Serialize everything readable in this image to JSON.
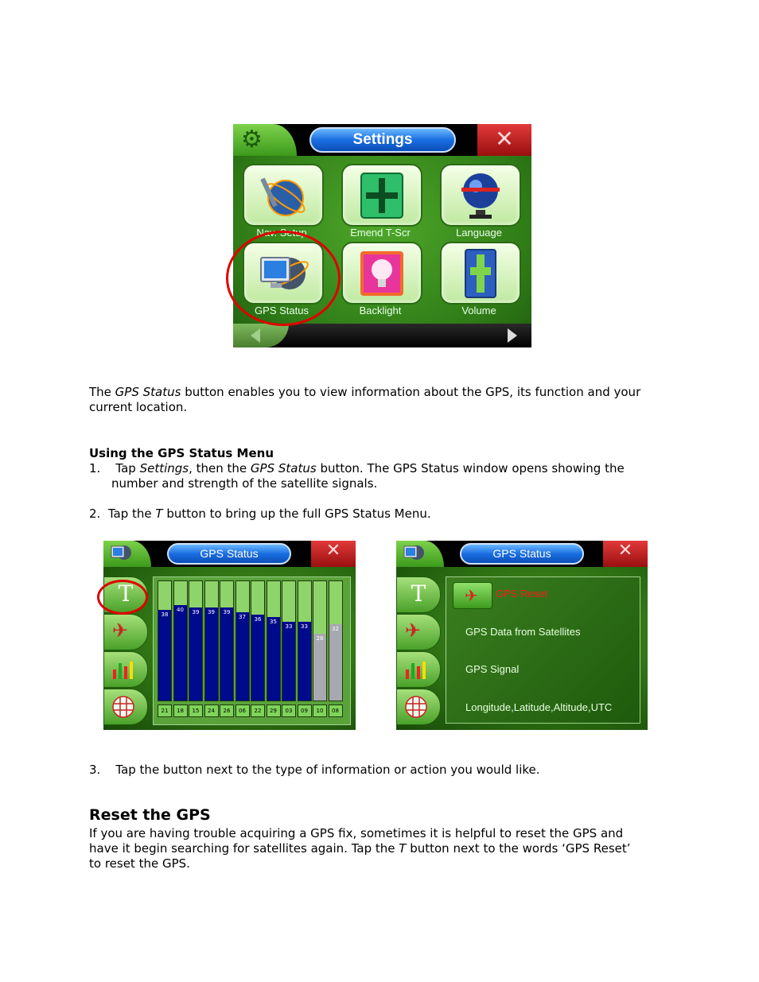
{
  "settings_screen": {
    "title": "Settings",
    "close_glyph": "✕",
    "tiles": [
      {
        "label": "Nav. Setup",
        "icon": "nav-setup-icon"
      },
      {
        "label": "Emend T-Scr",
        "icon": "touch-screen-calibrate-icon"
      },
      {
        "label": "Language",
        "icon": "globe-icon"
      },
      {
        "label": "GPS Status",
        "icon": "monitor-icon"
      },
      {
        "label": "Backlight",
        "icon": "lightbulb-icon"
      },
      {
        "label": "Volume",
        "icon": "speaker-icon"
      }
    ]
  },
  "intro": {
    "text_before": "The ",
    "emphasis": "GPS Status",
    "text_after": " button enables you to view information about the GPS, its function and your",
    "line2": "current location."
  },
  "using_section": {
    "heading": "Using the GPS Status Menu",
    "step1_num": "1.",
    "step1_a": "Tap ",
    "step1_b": "Settings",
    "step1_c": ", then the ",
    "step1_d": "GPS Status",
    "step1_e": " button.  The GPS Status window opens showing the",
    "step1_line2": "number and strength of the satellite signals.",
    "step2_num": "2.",
    "step2_a": "Tap the ",
    "step2_b": "T",
    "step2_c": "  button to bring up the full GPS Status Menu.",
    "step3_num": "3.",
    "step3_text": "Tap the button next to the type of information or action you would like."
  },
  "gps_screen": {
    "title": "GPS Status",
    "t_label": "T",
    "close_glyph": "✕"
  },
  "chart_data": {
    "type": "bar",
    "categories": [
      "21",
      "18",
      "15",
      "24",
      "26",
      "06",
      "22",
      "29",
      "03",
      "09",
      "10",
      "08"
    ],
    "values": [
      38,
      40,
      39,
      39,
      39,
      37,
      36,
      35,
      33,
      33,
      28,
      32
    ],
    "fix_status": [
      "used",
      "used",
      "used",
      "used",
      "used",
      "used",
      "used",
      "used",
      "used",
      "used",
      "not-used",
      "not-used"
    ],
    "colors": {
      "used": "#000a8c",
      "not_used": "#a8a8b0",
      "empty": "#8fd46a"
    },
    "ylim": [
      0,
      50
    ]
  },
  "gps_menu": {
    "items": [
      "GPS Reset",
      "GPS Data from Satellites",
      "GPS Signal",
      "Longitude,Latitude,Altitude,UTC"
    ],
    "reset_color": "#ff1a1a"
  },
  "reset_section": {
    "heading": "Reset the GPS",
    "line1": "If you are having trouble acquiring a GPS fix, sometimes it is helpful to reset the GPS and",
    "line2_a": "have it begin searching for satellites again.  Tap the ",
    "line2_b": "T",
    "line2_c": " button next to the words ‘GPS Reset’",
    "line3": "to reset the GPS."
  }
}
